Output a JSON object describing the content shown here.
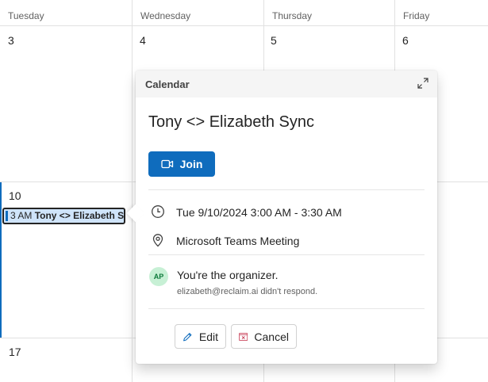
{
  "calendar": {
    "columns": [
      "Tuesday",
      "Wednesday",
      "Thursday",
      "Friday"
    ],
    "week1_days": [
      "3",
      "4",
      "5",
      "6"
    ],
    "week2_days": [
      "10"
    ],
    "week3_days": [
      "17"
    ],
    "event_chip": {
      "time": "3 AM",
      "title": "Tony <> Elizabeth Sync"
    }
  },
  "popup": {
    "header": "Calendar",
    "title": "Tony <> Elizabeth Sync",
    "join_label": "Join",
    "datetime": "Tue 9/10/2024 3:00 AM - 3:30 AM",
    "location": "Microsoft Teams Meeting",
    "avatar_initials": "AP",
    "organizer_text": "You're the organizer.",
    "response_text": "elizabeth@reclaim.ai didn't respond.",
    "edit_label": "Edit",
    "cancel_label": "Cancel"
  },
  "icons": {
    "expand": "expand-icon",
    "video": "video-icon",
    "clock": "clock-icon",
    "location": "location-pin-icon",
    "edit": "pencil-icon",
    "cancel": "cancel-calendar-icon"
  },
  "colors": {
    "accent": "#0f6cbd",
    "chip_bg": "#cfe4fa",
    "avatar_bg": "#c7f0d5",
    "cancel_icon": "#c4314b"
  }
}
